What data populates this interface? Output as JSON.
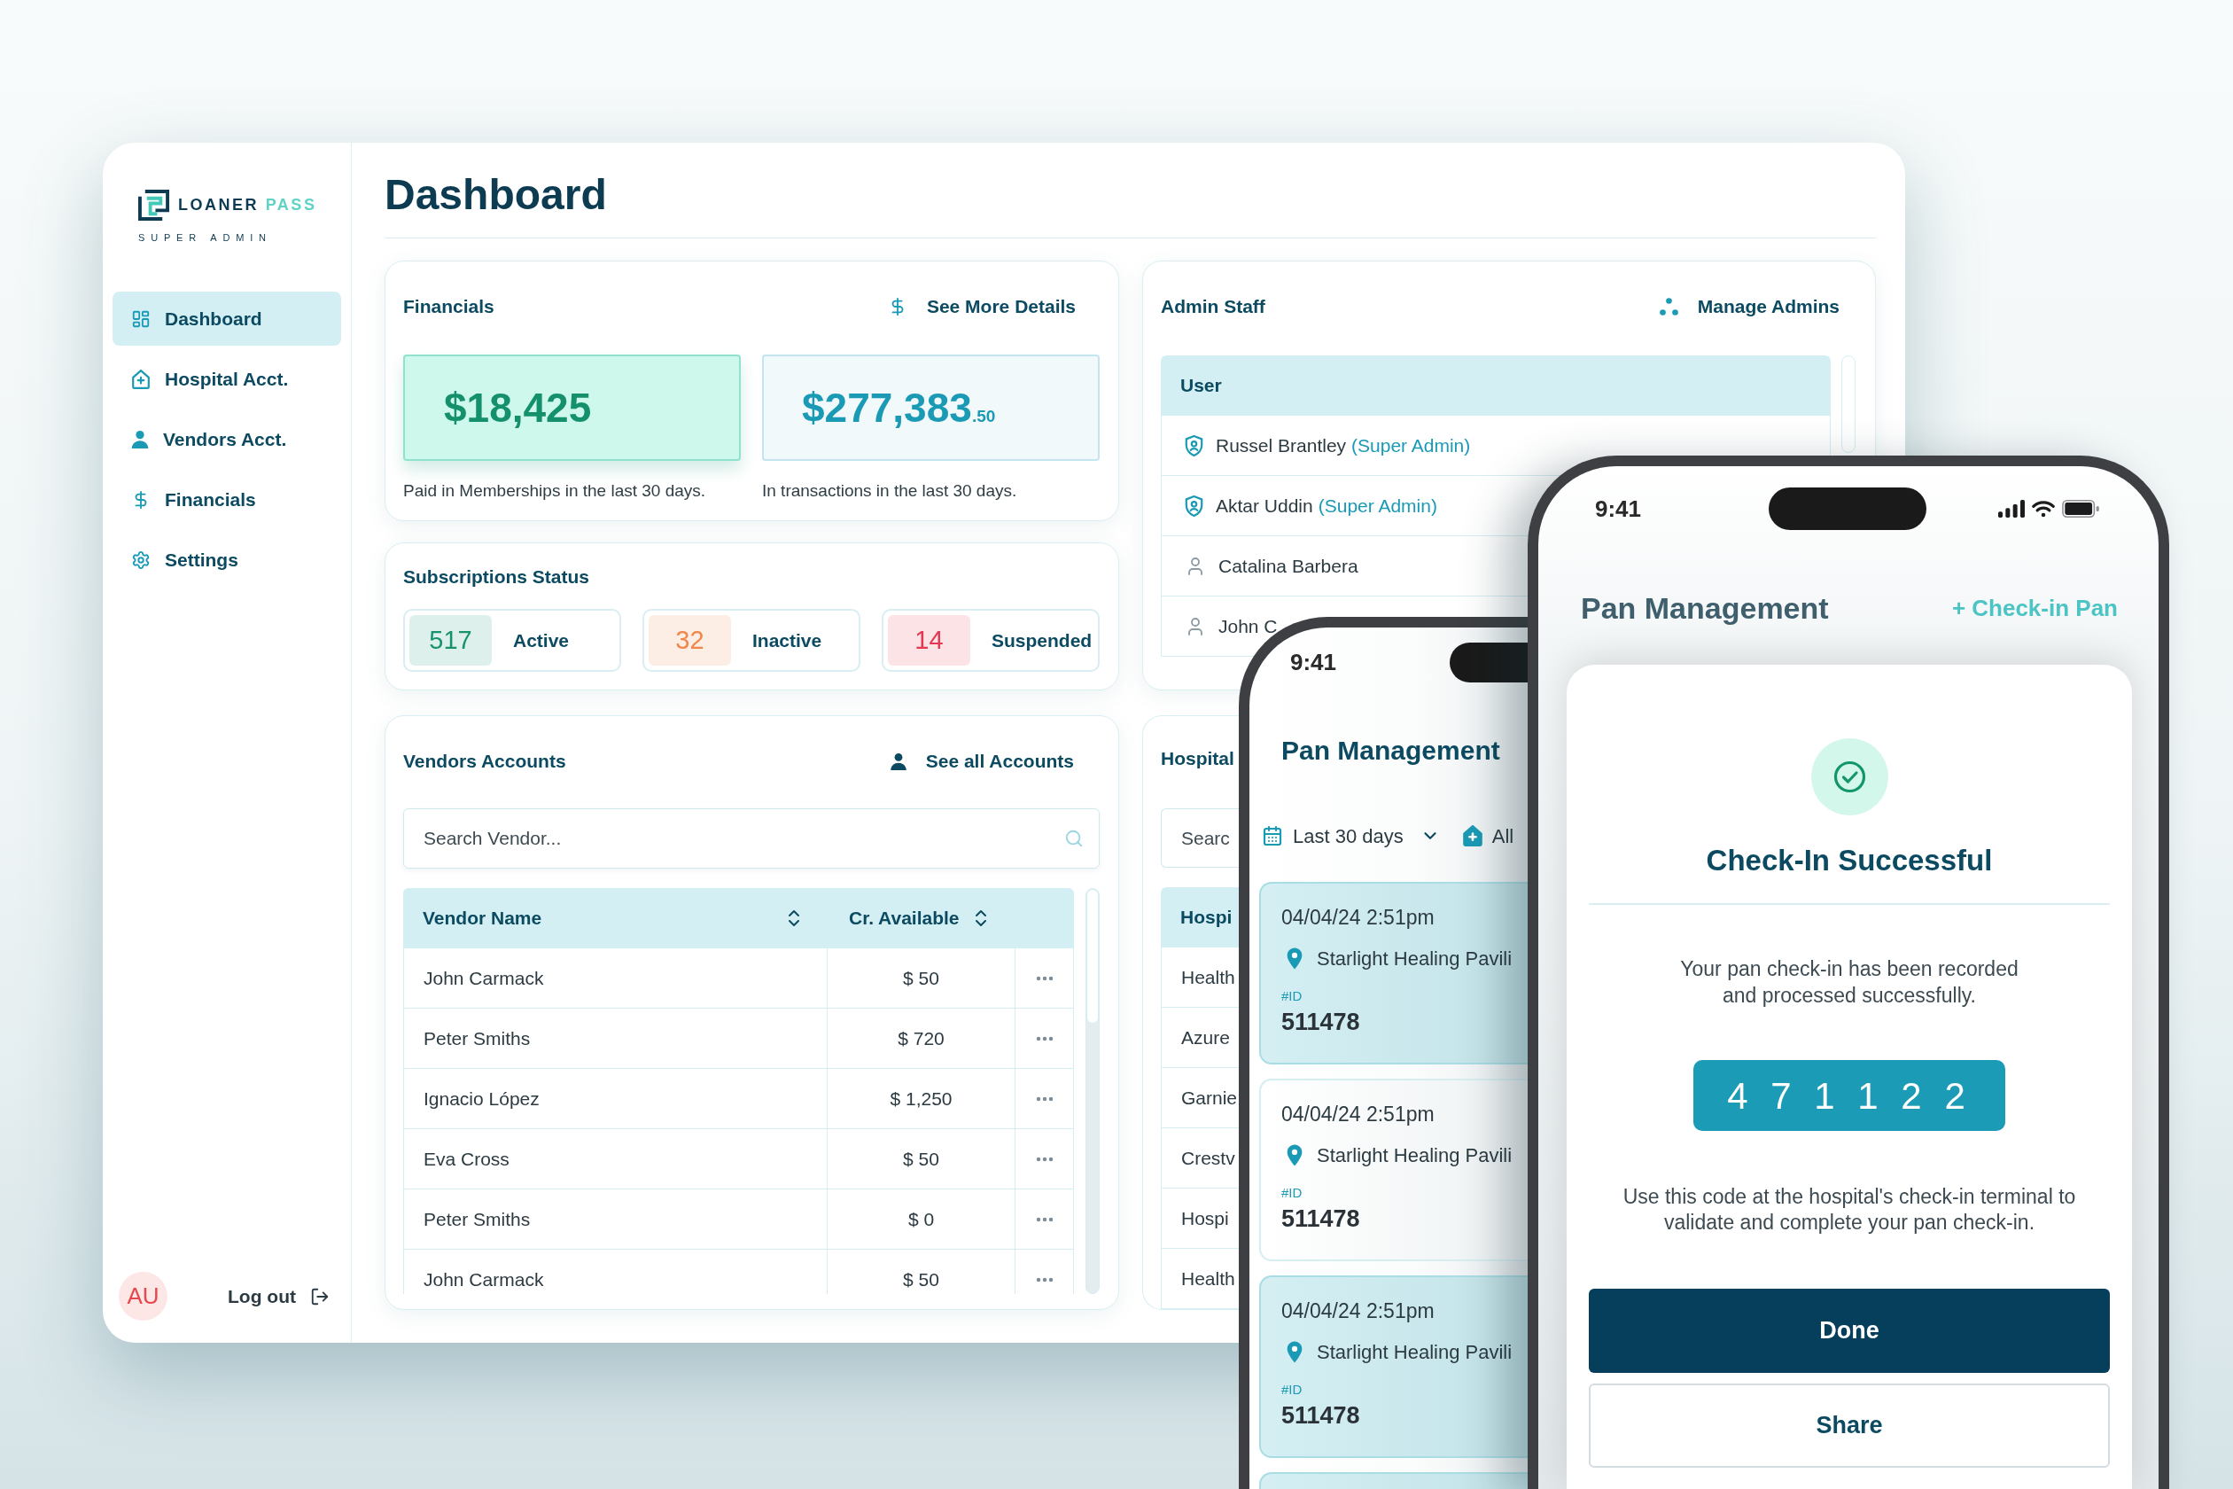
{
  "sidebar": {
    "logo": {
      "word_1": "LOANER",
      "word_2": "PASS",
      "subtitle": "SUPER ADMIN"
    },
    "items": [
      {
        "kind": "dashboard",
        "label": "Dashboard",
        "selected": true
      },
      {
        "kind": "hospital",
        "label": "Hospital Acct.",
        "selected": false
      },
      {
        "kind": "vendors",
        "label": "Vendors Acct.",
        "selected": false
      },
      {
        "kind": "financials",
        "label": "Financials",
        "selected": false
      },
      {
        "kind": "settings",
        "label": "Settings",
        "selected": false
      }
    ],
    "user": {
      "initials": "AU"
    },
    "logout": "Log out"
  },
  "header": {
    "title": "Dashboard"
  },
  "financials": {
    "title": "Financials",
    "link": "See More Details",
    "stats": [
      {
        "kind": "highlight",
        "amount": "$18,425",
        "caption": "Paid in Memberships in the last 30 days."
      },
      {
        "kind": "plain",
        "amount": "$277,383",
        "cents": ".50",
        "caption": "In transactions in the last 30 days."
      }
    ]
  },
  "subscriptions": {
    "title": "Subscriptions Status",
    "items": [
      {
        "count": "517",
        "label": "Active",
        "color": "#17926f"
      },
      {
        "count": "32",
        "label": "Inactive",
        "color": "#f0874a"
      },
      {
        "count": "14",
        "label": "Suspended",
        "color": "#e5374f"
      }
    ]
  },
  "admin_staff": {
    "title": "Admin Staff",
    "link": "Manage Admins",
    "column": "User",
    "rows": [
      {
        "kind": "admin",
        "name": "Russel Brantley",
        "role": "(Super Admin)"
      },
      {
        "kind": "admin",
        "name": "Aktar Uddin",
        "role": "(Super Admin)"
      },
      {
        "kind": "user",
        "name": "Catalina Barbera"
      },
      {
        "kind": "user",
        "name": "John C"
      }
    ]
  },
  "vendors": {
    "title": "Vendors Accounts",
    "link": "See all Accounts",
    "search": {
      "placeholder": "Search Vendor..."
    },
    "columns": [
      "Vendor Name",
      "Cr. Available"
    ],
    "rows": [
      {
        "name": "John Carmack",
        "credit": "$ 50"
      },
      {
        "name": "Peter Smiths",
        "credit": "$ 720"
      },
      {
        "name": "Ignacio López",
        "credit": "$ 1,250"
      },
      {
        "name": "Eva Cross",
        "credit": "$ 50"
      },
      {
        "name": "Peter Smiths",
        "credit": "$ 0"
      },
      {
        "name": "John Carmack",
        "credit": "$ 50"
      }
    ]
  },
  "hospitals": {
    "title": "Hospital",
    "search": {
      "placeholder": "Searc"
    },
    "column": "Hospi",
    "rows": [
      "Health",
      "Azure",
      "Garnie",
      "Crestv",
      "Hospi",
      "Health"
    ]
  },
  "phone_list": {
    "time": "9:41",
    "title": "Pan Management",
    "filters": [
      {
        "kind": "date",
        "label": "Last 30 days"
      },
      {
        "kind": "hospital",
        "label": "All"
      }
    ],
    "cards": [
      {
        "highlighted": true,
        "datetime": "04/04/24 2:51pm",
        "location": "Starlight Healing Pavili",
        "id_label": "#ID",
        "id": "511478"
      },
      {
        "highlighted": false,
        "datetime": "04/04/24 2:51pm",
        "location": "Starlight Healing Pavili",
        "id_label": "#ID",
        "id": "511478"
      },
      {
        "highlighted": true,
        "datetime": "04/04/24 2:51pm",
        "location": "Starlight Healing Pavili",
        "id_label": "#ID",
        "id": "511478"
      },
      {
        "highlighted": true
      }
    ]
  },
  "phone_modal": {
    "time": "9:41",
    "background": {
      "title": "Pan Management",
      "action": "+ Check-in Pan"
    },
    "modal": {
      "title": "Check-In Successful",
      "message": "Your pan check-in has been recorded and processed successfully.",
      "code": "4 7 1 1 2 2",
      "instructions": "Use this code at the hospital's check-in terminal to validate and complete your pan check-in.",
      "buttons": [
        {
          "kind": "primary",
          "label": "Done"
        },
        {
          "kind": "secondary",
          "label": "Share"
        }
      ]
    }
  }
}
